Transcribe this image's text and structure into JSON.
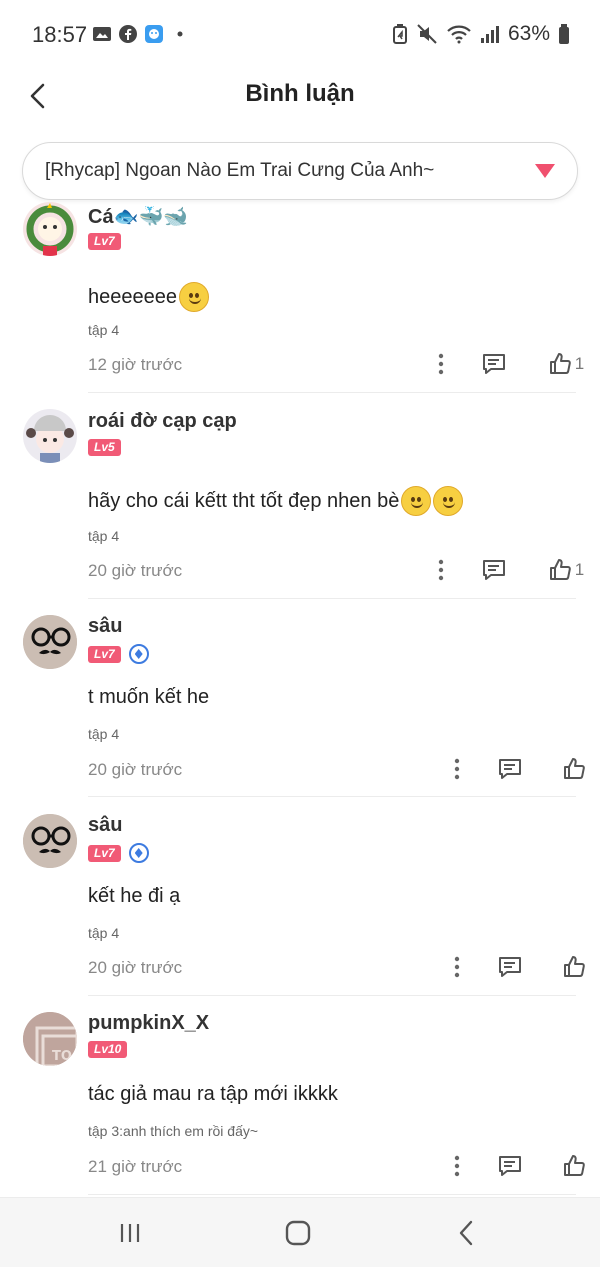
{
  "status_bar": {
    "time": "18:57",
    "battery": "63%"
  },
  "header": {
    "title": "Bình luận"
  },
  "chapter_select": {
    "value": "[Rhycap] Ngoan Nào Em Trai Cưng Của Anh~"
  },
  "comments": [
    {
      "user": "Cá🐟🐳🐋",
      "level": "Lv7",
      "verified": false,
      "text": "heeeeeee",
      "chapter": "tập 4",
      "time": "12 giờ trước",
      "likes": "1",
      "avatar_color": "#f6e3e3"
    },
    {
      "user": "roái đờ cạp cạp",
      "level": "Lv5",
      "verified": false,
      "text": "hãy cho cái kếtt tht tốt đẹp nhen bè",
      "chapter": "tập 4",
      "time": "20 giờ trước",
      "likes": "1",
      "avatar_color": "#eceaf0"
    },
    {
      "user": "sâu",
      "level": "Lv7",
      "verified": true,
      "text": "t muốn kết he",
      "chapter": "tập 4",
      "time": "20 giờ trước",
      "likes": "",
      "avatar_color": "#c7b9ae"
    },
    {
      "user": "sâu",
      "level": "Lv7",
      "verified": true,
      "text": "kết he đi ạ",
      "chapter": "tập 4",
      "time": "20 giờ trước",
      "likes": "",
      "avatar_color": "#c7b9ae"
    },
    {
      "user": "pumpkinX_X",
      "level": "Lv10",
      "verified": false,
      "text": "tác giả mau ra tập mới ikkkk",
      "chapter": "tập 3:anh thích em rồi đấy~",
      "time": "21 giờ trước",
      "likes": "",
      "avatar_color": "#bfa59d"
    }
  ],
  "colors": {
    "accent": "#f15a76",
    "verified": "#3d7be0"
  },
  "icons": [
    "back-arrow-icon",
    "dropdown-triangle-icon",
    "more-vertical-icon",
    "reply-icon",
    "thumbs-up-icon",
    "recent-apps-icon",
    "home-icon",
    "back-nav-icon"
  ]
}
